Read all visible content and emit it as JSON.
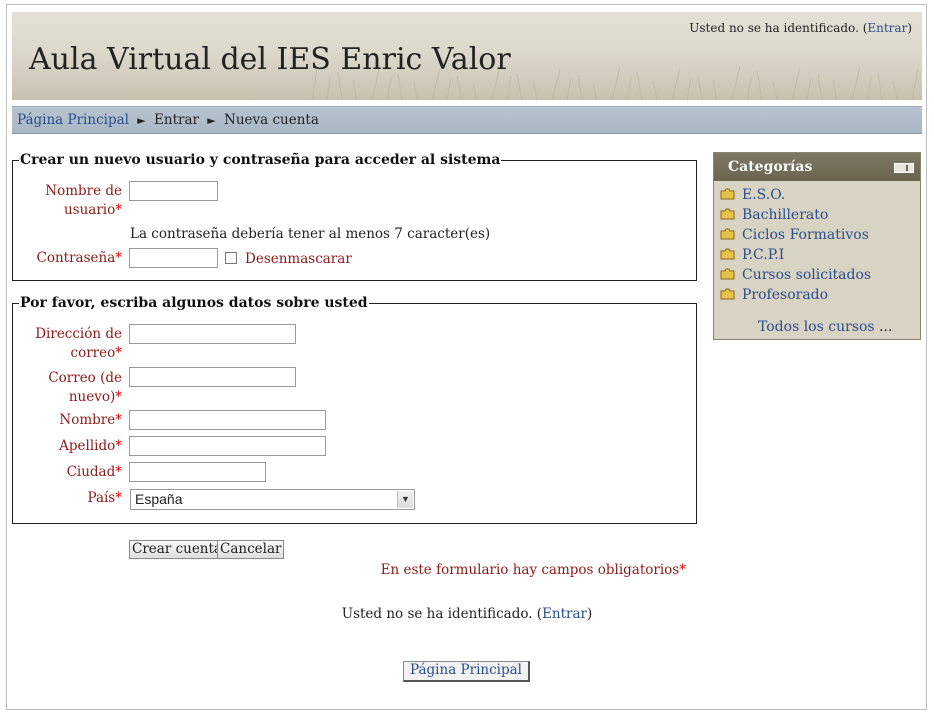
{
  "header": {
    "site_title": "Aula Virtual del IES Enric Valor",
    "login_text": "Usted no se ha identificado. (",
    "login_link": "Entrar",
    "login_close": ")"
  },
  "breadcrumb": {
    "home": "Página Principal",
    "step1": "Entrar",
    "step2": "Nueva cuenta",
    "separator": "►"
  },
  "section1": {
    "legend": "Crear un nuevo usuario y contraseña para acceder al sistema",
    "username_label_1": "Nombre de",
    "username_label_2": "usuario",
    "password_hint": "La contraseña debería tener al menos 7 caracter(es)",
    "password_label": "Contraseña",
    "unmask_label": "Desenmascarar"
  },
  "section2": {
    "legend": "Por favor, escriba algunos datos sobre usted",
    "email_label_1": "Dirección de",
    "email_label_2": "correo",
    "email2_label_1": "Correo (de",
    "email2_label_2": "nuevo)",
    "firstname_label": "Nombre",
    "lastname_label": "Apellido",
    "city_label": "Ciudad",
    "country_label": "País",
    "country_value": "España"
  },
  "required_mark": "*",
  "buttons": {
    "create": "Crear cuenta",
    "cancel": "Cancelar"
  },
  "required_note": "En este formulario hay campos obligatorios",
  "footer": {
    "login_text": "Usted no se ha identificado. (",
    "login_link": "Entrar",
    "login_close": ")",
    "home_button": "Página Principal"
  },
  "categories": {
    "title": "Categorías",
    "items": [
      "E.S.O.",
      "Bachillerato",
      "Ciclos Formativos",
      "P.C.P.I",
      "Cursos solicitados",
      "Profesorado"
    ],
    "all_courses": "Todos los cursos",
    "all_courses_suffix": "..."
  },
  "colors": {
    "link": "#2a4d8c",
    "label": "#8b1a1a",
    "required": "#dd0000",
    "block_header": "#6b644f"
  }
}
